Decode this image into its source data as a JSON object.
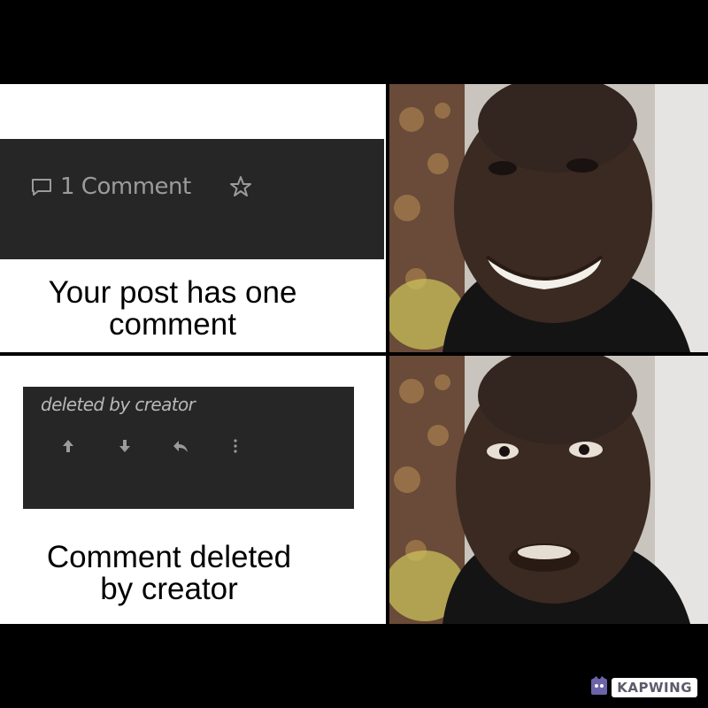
{
  "panels": {
    "top": {
      "comment_count_label": "1 Comment",
      "caption_line1": "Your post has one",
      "caption_line2": "comment",
      "mood": "happy"
    },
    "bottom": {
      "deleted_label": "deleted by creator",
      "caption_line1": "Comment deleted",
      "caption_line2": "by creator",
      "mood": "disappointed"
    }
  },
  "icons": {
    "comment": "comment-bubble-icon",
    "star": "star-icon",
    "upvote": "arrow-up-icon",
    "downvote": "arrow-down-icon",
    "reply": "reply-icon",
    "more": "more-vertical-icon"
  },
  "watermark": {
    "text": "KAPWING"
  },
  "colors": {
    "panel_dark": "#262626",
    "muted_text": "#9b9b9b",
    "background": "#000000"
  }
}
